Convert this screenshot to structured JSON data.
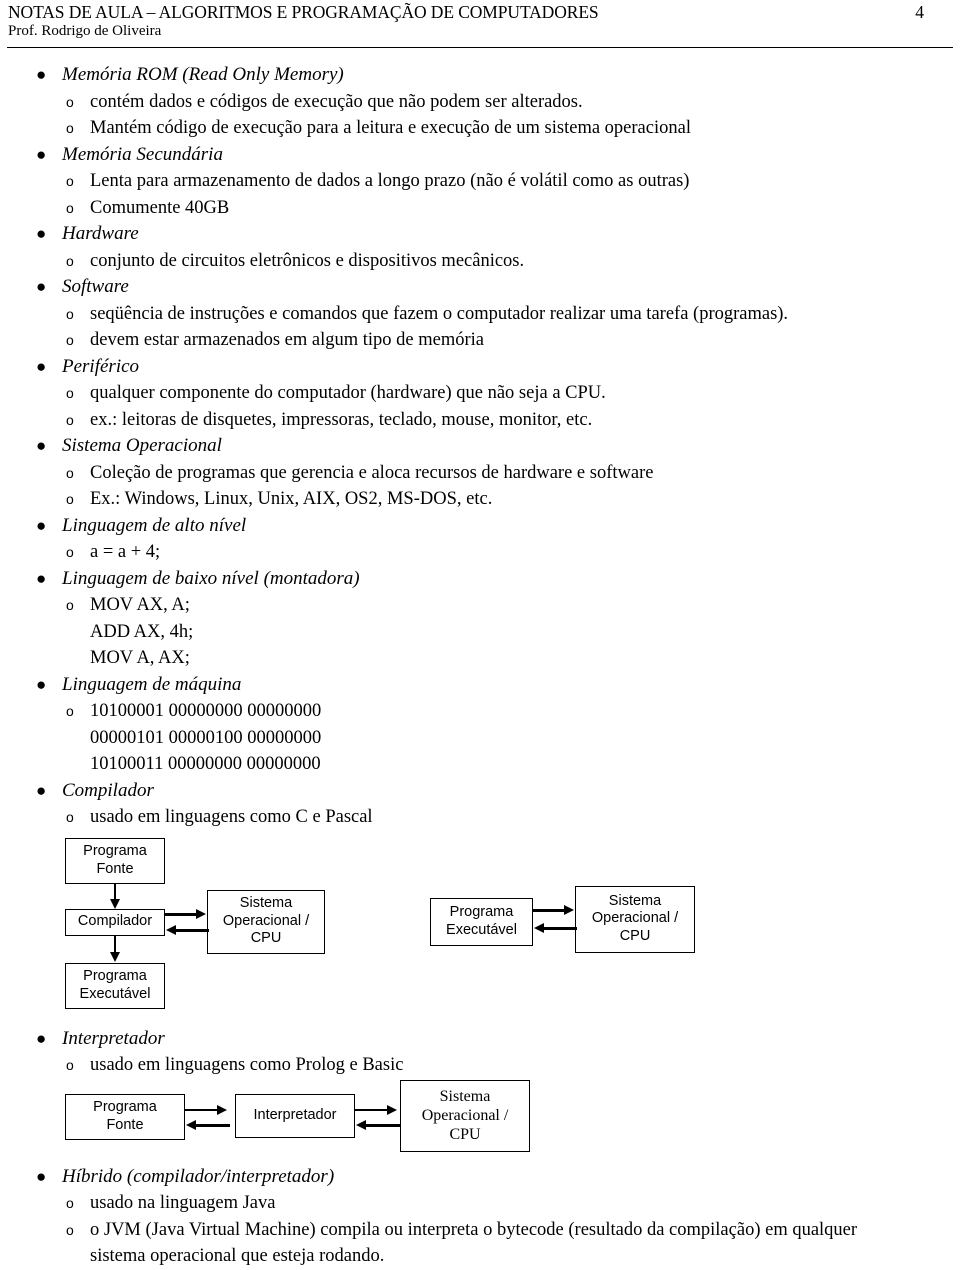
{
  "header": {
    "title": "NOTAS DE AULA – ALGORITMOS E PROGRAMAÇÃO DE COMPUTADORES",
    "author": "Prof. Rodrigo de Oliveira",
    "page_number": "4"
  },
  "bullet_glyph": "●",
  "sub_glyph": "o",
  "outline": [
    {
      "title": "Memória ROM (Read Only Memory)",
      "items": [
        "contém dados e códigos de execução que não podem ser alterados.",
        "Mantém código de execução para a leitura e execução de um sistema operacional"
      ]
    },
    {
      "title": "Memória Secundária",
      "items": [
        "Lenta para armazenamento de dados a longo prazo (não é volátil como as outras)",
        "Comumente 40GB"
      ]
    },
    {
      "title": "Hardware",
      "items": [
        "conjunto de circuitos eletrônicos e dispositivos mecânicos."
      ]
    },
    {
      "title": "Software",
      "items": [
        "seqüência de instruções e comandos que fazem o computador realizar uma tarefa (programas).",
        "devem estar armazenados em algum tipo de memória"
      ]
    },
    {
      "title": "Periférico",
      "items": [
        "qualquer componente do computador (hardware) que não seja a CPU.",
        "ex.: leitoras de disquetes, impressoras, teclado, mouse, monitor, etc."
      ]
    },
    {
      "title": "Sistema Operacional",
      "items": [
        "Coleção de programas que gerencia e aloca recursos de hardware e software",
        "Ex.: Windows, Linux, Unix, AIX, OS2, MS-DOS, etc."
      ]
    },
    {
      "title": "Linguagem de alto nível",
      "items": [
        "a = a + 4;"
      ]
    },
    {
      "title": "Linguagem de baixo nível (montadora)",
      "items": [
        "MOV AX, A;"
      ],
      "extra_lines": [
        "ADD AX, 4h;",
        "MOV A, AX;"
      ]
    },
    {
      "title": "Linguagem de máquina",
      "items": [
        "10100001 00000000 00000000"
      ],
      "extra_lines": [
        "00000101 00000100 00000000",
        "10100011 00000000 00000000"
      ]
    },
    {
      "title": "Compilador",
      "items": [
        "usado em linguagens como C e Pascal"
      ]
    },
    {
      "title": "Interpretador",
      "items": [
        "usado em linguagens como Prolog e Basic"
      ]
    }
  ],
  "hibrido": {
    "title": "Híbrido (compilador/interpretador)",
    "items": [
      "usado na linguagem Java"
    ],
    "long_item_line1": "o JVM (Java Virtual Machine) compila ou interpreta o bytecode (resultado da compilação) em qualquer",
    "long_item_line2": "sistema operacional que esteja rodando."
  },
  "diagram_compilador": {
    "programa_fonte": "Programa\nFonte",
    "programa_fonte_l1": "Programa",
    "programa_fonte_l2": "Fonte",
    "compilador": "Compilador",
    "so_cpu_l1": "Sistema",
    "so_cpu_l2": "Operacional /",
    "so_cpu_l3": "CPU",
    "programa_executavel_l1": "Programa",
    "programa_executavel_l2": "Executável",
    "right_programa_executavel_l1": "Programa",
    "right_programa_executavel_l2": "Executável",
    "right_so_cpu_l1": "Sistema",
    "right_so_cpu_l2": "Operacional /",
    "right_so_cpu_l3": "CPU"
  },
  "diagram_interpretador": {
    "programa_fonte_l1": "Programa",
    "programa_fonte_l2": "Fonte",
    "interpretador": "Interpretador",
    "so_cpu_l1": "Sistema",
    "so_cpu_l2": "Operacional /",
    "so_cpu_l3": "CPU"
  },
  "colors": {
    "text": "#000000",
    "background": "#ffffff",
    "rule": "#000000"
  }
}
